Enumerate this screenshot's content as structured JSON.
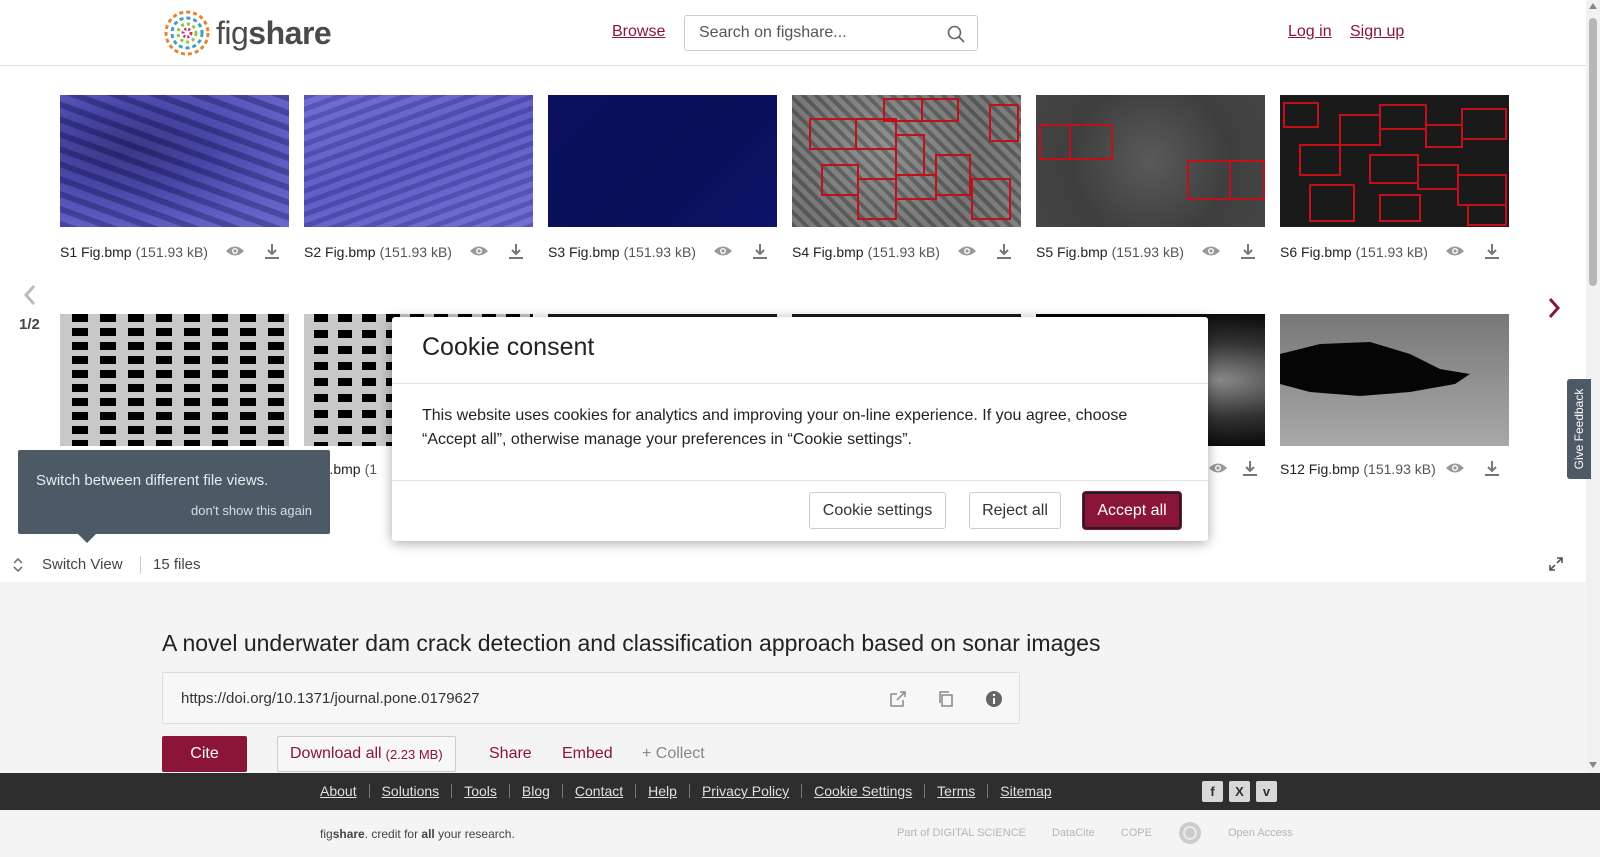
{
  "header": {
    "logo_text_regular": "fig",
    "logo_text_bold": "share",
    "browse": "Browse",
    "search_placeholder": "Search on figshare...",
    "login": "Log in",
    "signup": "Sign up"
  },
  "gallery": {
    "page_indicator": "1/2",
    "files": [
      {
        "name": "S1 Fig.bmp",
        "size": "(151.93 kB)"
      },
      {
        "name": "S2 Fig.bmp",
        "size": "(151.93 kB)"
      },
      {
        "name": "S3 Fig.bmp",
        "size": "(151.93 kB)"
      },
      {
        "name": "S4 Fig.bmp",
        "size": "(151.93 kB)"
      },
      {
        "name": "S5 Fig.bmp",
        "size": "(151.93 kB)"
      },
      {
        "name": "S6 Fig.bmp",
        "size": "(151.93 kB)"
      },
      {
        "name": "Fig.bmp",
        "size": "(1"
      },
      {
        "name": "S12 Fig.bmp",
        "size": "(151.93 kB)"
      }
    ]
  },
  "tooltip": {
    "text": "Switch between different file views.",
    "dismiss": "don't show this again"
  },
  "switch_bar": {
    "label": "Switch View",
    "files_count": "15 files"
  },
  "article": {
    "title": "A novel underwater dam crack detection and classification approach based on sonar images",
    "doi": "https://doi.org/10.1371/journal.pone.0179627",
    "cite": "Cite",
    "download_all": "Download all",
    "download_size": "(2.23 MB)",
    "share": "Share",
    "embed": "Embed",
    "collect": "+ Collect"
  },
  "feedback": "Give Feedback",
  "footer": {
    "links": [
      "About",
      "Solutions",
      "Tools",
      "Blog",
      "Contact",
      "Help",
      "Privacy Policy",
      "Cookie Settings",
      "Terms",
      "Sitemap"
    ],
    "tagline_pre": "fig",
    "tagline_bold": "share",
    "tagline_mid": ". credit for ",
    "tagline_all": "all",
    "tagline_post": " your research.",
    "partners": [
      "Part of DIGITAL SCIENCE",
      "DataCite",
      "COPE",
      "",
      "Open Access"
    ]
  },
  "cookie_modal": {
    "title": "Cookie consent",
    "body": "This website uses cookies for analytics and improving your on-line experience. If you agree, choose “Accept all”, otherwise manage your preferences in “Cookie settings”.",
    "settings": "Cookie settings",
    "reject": "Reject all",
    "accept": "Accept all"
  },
  "colors": {
    "brand": "#8a1538",
    "tooltip_bg": "#4d5a66",
    "footer_dark": "#2e2e2e"
  }
}
